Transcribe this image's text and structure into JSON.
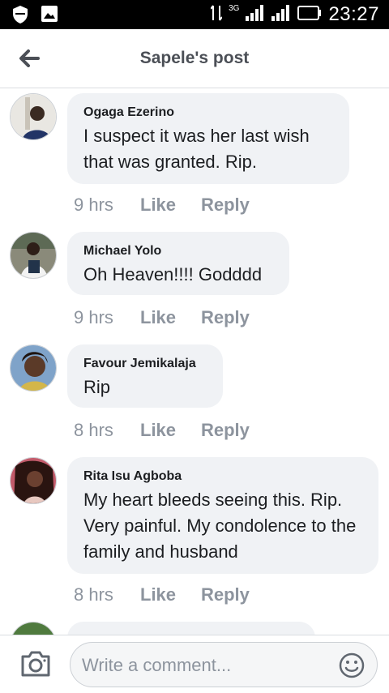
{
  "status_bar": {
    "time": "23:27",
    "network": "3G"
  },
  "header": {
    "title": "Sapele's post"
  },
  "comments": [
    {
      "author": "Ogaga Ezerino",
      "text": "I suspect it was her last wish that was granted. Rip.",
      "time": "9 hrs",
      "like_label": "Like",
      "reply_label": "Reply"
    },
    {
      "author": "Michael Yolo",
      "text": "Oh Heaven!!!! Godddd",
      "time": "9 hrs",
      "like_label": "Like",
      "reply_label": "Reply"
    },
    {
      "author": "Favour Jemikalaja",
      "text": "Rip",
      "time": "8 hrs",
      "like_label": "Like",
      "reply_label": "Reply"
    },
    {
      "author": "Rita Isu Agboba",
      "text": "My heart bleeds seeing this. Rip. Very painful. My condolence to the family and husband",
      "time": "8 hrs",
      "like_label": "Like",
      "reply_label": "Reply"
    }
  ],
  "composer": {
    "placeholder": "Write a comment..."
  },
  "colors": {
    "bubble": "#f0f2f5",
    "meta": "#8d949e",
    "title": "#4b4f56",
    "statusbar": "#000000"
  }
}
